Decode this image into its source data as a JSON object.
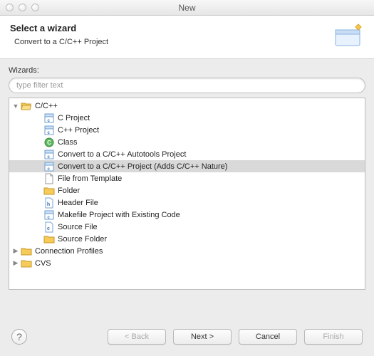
{
  "window": {
    "title": "New"
  },
  "header": {
    "title": "Select a wizard",
    "subtitle": "Convert to a C/C++ Project"
  },
  "wizards": {
    "label": "Wizards:",
    "filter_placeholder": "type filter text",
    "tree": [
      {
        "label": "C/C++",
        "icon": "folder-open",
        "expanded": true,
        "depth": 1
      },
      {
        "label": "C Project",
        "icon": "c-file",
        "depth": 2
      },
      {
        "label": "C++ Project",
        "icon": "c-file",
        "depth": 2
      },
      {
        "label": "Class",
        "icon": "class",
        "depth": 2
      },
      {
        "label": "Convert to a C/C++ Autotools Project",
        "icon": "c-file",
        "depth": 2
      },
      {
        "label": "Convert to a C/C++ Project (Adds C/C++ Nature)",
        "icon": "c-file",
        "depth": 2,
        "selected": true
      },
      {
        "label": "File from Template",
        "icon": "file",
        "depth": 2
      },
      {
        "label": "Folder",
        "icon": "folder-closed",
        "depth": 2
      },
      {
        "label": "Header File",
        "icon": "h-file",
        "depth": 2
      },
      {
        "label": "Makefile Project with Existing Code",
        "icon": "c-file",
        "depth": 2
      },
      {
        "label": "Source File",
        "icon": "c-file-s",
        "depth": 2
      },
      {
        "label": "Source Folder",
        "icon": "folder-closed",
        "depth": 2
      },
      {
        "label": "Connection Profiles",
        "icon": "folder-closed",
        "expanded": false,
        "depth": 1
      },
      {
        "label": "CVS",
        "icon": "folder-closed",
        "expanded": false,
        "depth": 1
      }
    ]
  },
  "buttons": {
    "back": "< Back",
    "next": "Next >",
    "cancel": "Cancel",
    "finish": "Finish"
  }
}
